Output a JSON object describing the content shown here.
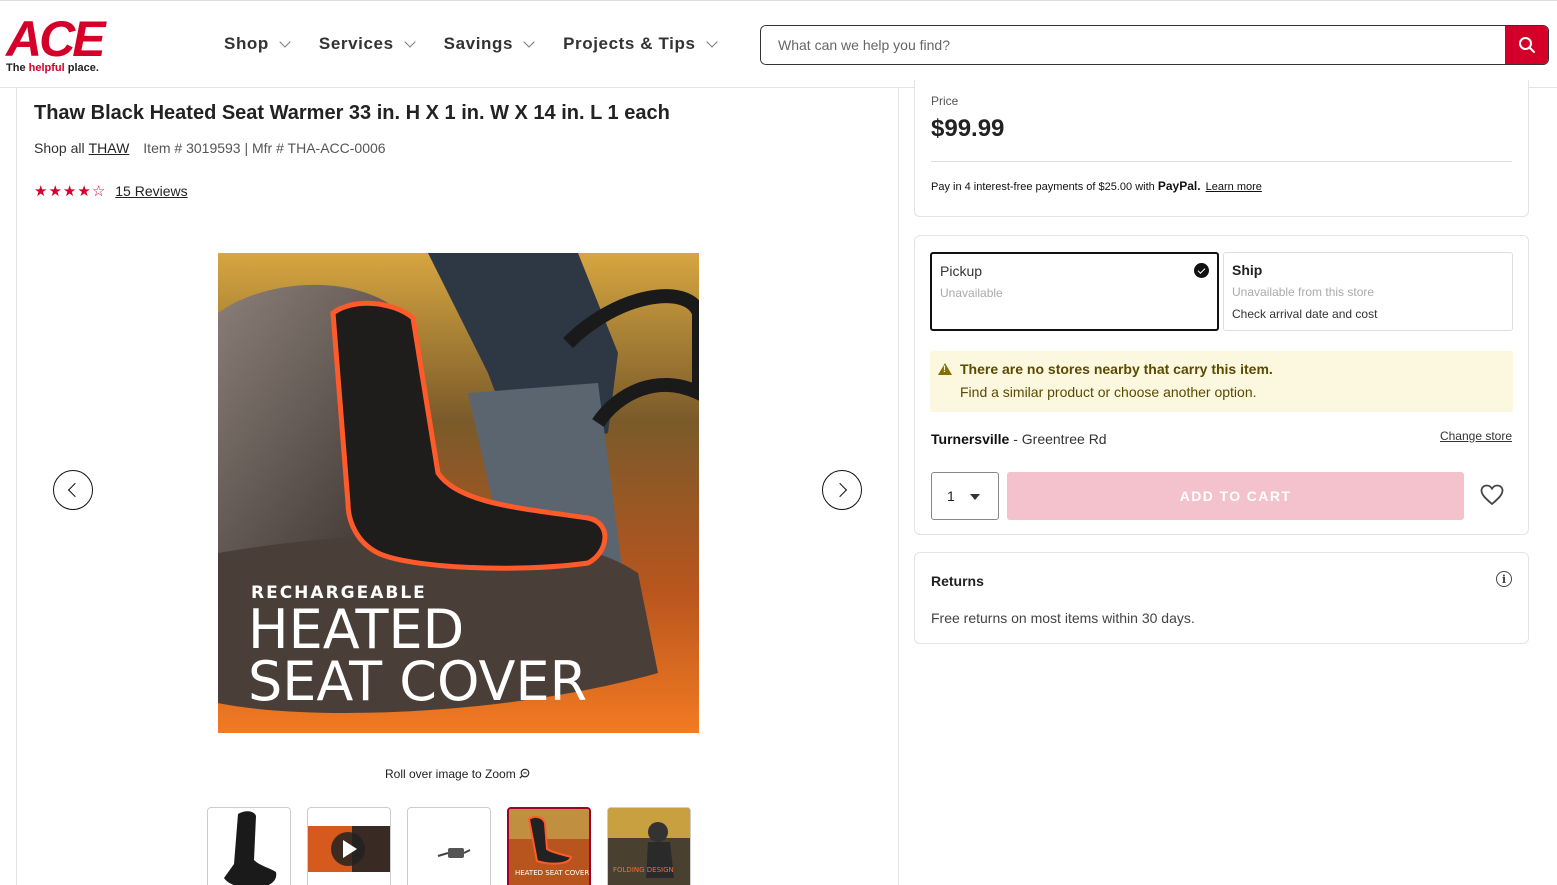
{
  "header": {
    "logo_text": "ACE",
    "logo_tag_prefix": "The ",
    "logo_tag_highlight": "helpful",
    "logo_tag_suffix": " place.",
    "nav": [
      {
        "label": "Shop"
      },
      {
        "label": "Services"
      },
      {
        "label": "Savings"
      },
      {
        "label": "Projects & Tips"
      }
    ],
    "search_placeholder": "What can we help you find?"
  },
  "product": {
    "title": "Thaw Black Heated Seat Warmer 33 in. H X 1 in. W X 14 in. L 1 each",
    "shop_all_label": "Shop all",
    "brand": "THAW",
    "item_info": "Item # 3019593 | Mfr # THA-ACC-0006",
    "rating": 4.5,
    "reviews_label": "15 Reviews",
    "image_text_line1": "RECHARGEABLE",
    "image_text_line2": "HEATED",
    "image_text_line3": "SEAT COVER",
    "zoom_hint": "Roll over image to Zoom",
    "thumbnails": [
      {
        "name": "seat-black"
      },
      {
        "name": "video"
      },
      {
        "name": "charger"
      },
      {
        "name": "heated-seat-cover",
        "active": true
      },
      {
        "name": "folding-design"
      }
    ],
    "thumb_text_1": "HEATED SEAT COVER",
    "thumb_text_2": "FOLDING DESIGN"
  },
  "price_card": {
    "label": "Price",
    "price": "$99.99",
    "paypal_text": "Pay in 4 interest-free payments of $25.00 with",
    "paypal_brand": "PayPal.",
    "learn_more": "Learn more"
  },
  "fulfillment": {
    "pickup_title": "Pickup",
    "pickup_status": "Unavailable",
    "ship_title": "Ship",
    "ship_status": "Unavailable from this store",
    "ship_note": "Check arrival date and cost",
    "alert_line1": "There are no stores nearby that carry this item.",
    "alert_line2": "Find a similar product or choose another option.",
    "store_name": "Turnersville",
    "store_area": " - Greentree Rd",
    "change_store": "Change store",
    "quantity": "1",
    "add_to_cart": "ADD TO CART"
  },
  "returns": {
    "title": "Returns",
    "text": "Free returns on most items within 30 days."
  },
  "colors": {
    "brand_red": "#d40029",
    "alert_bg": "#fbf8df",
    "disabled_cart": "#f4c2cc"
  }
}
